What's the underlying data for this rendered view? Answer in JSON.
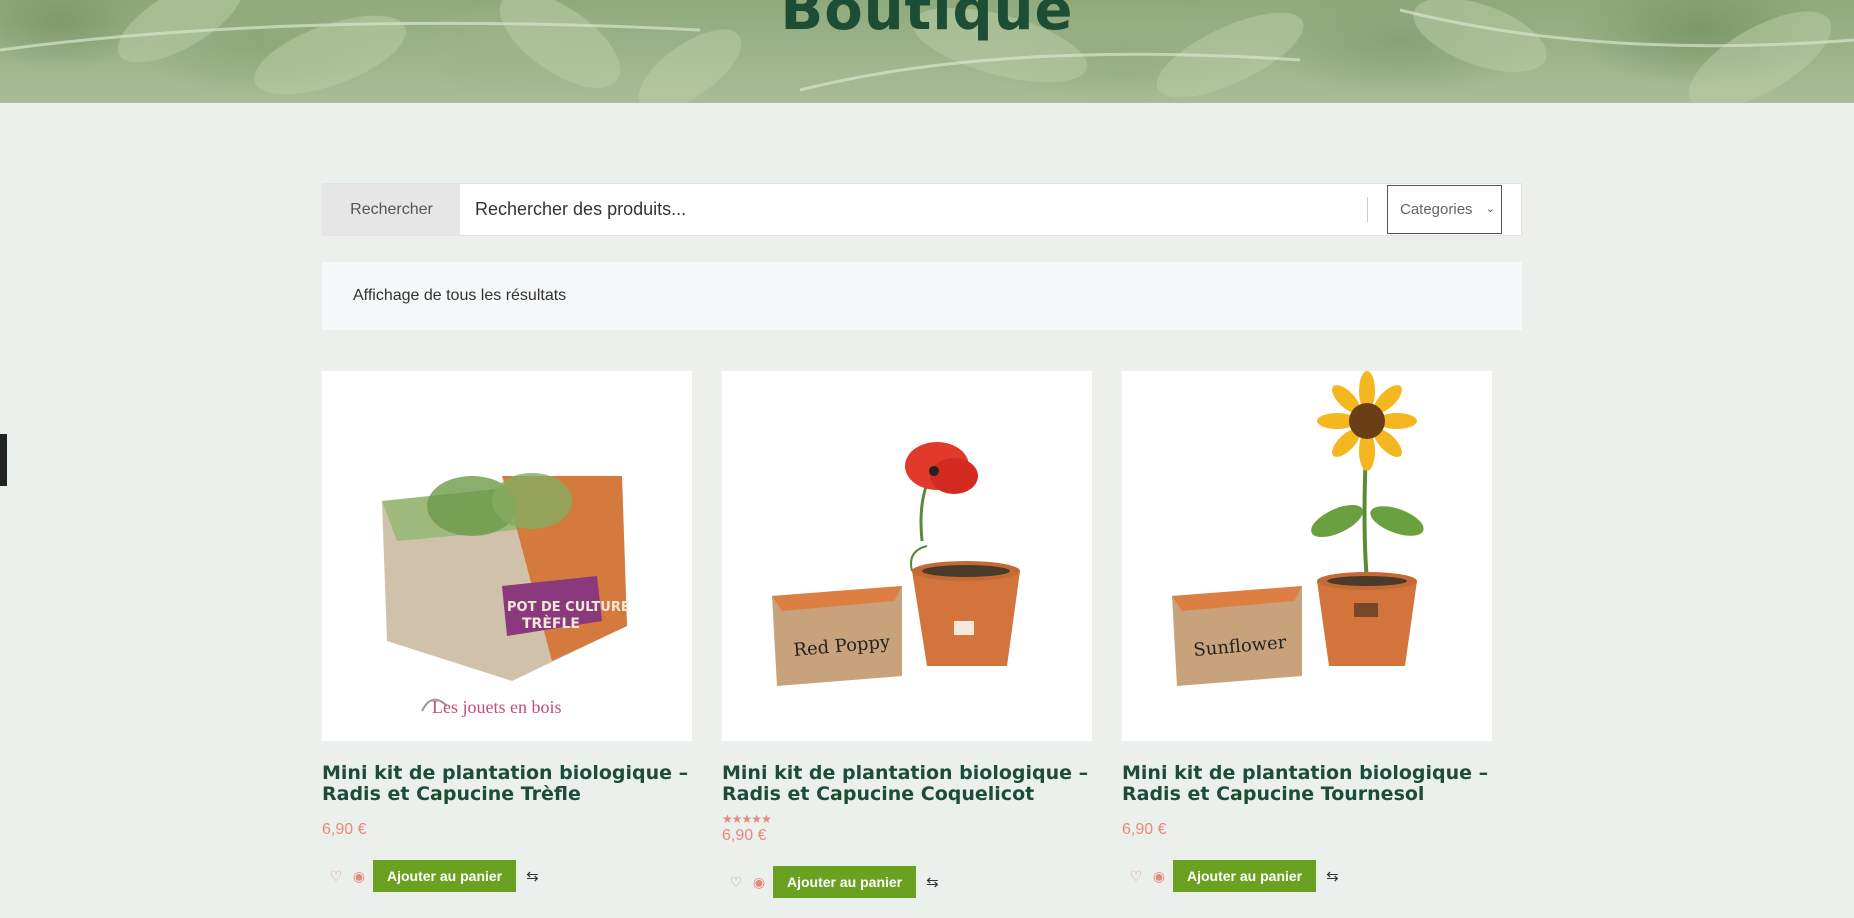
{
  "hero": {
    "title": "Boutique"
  },
  "search": {
    "label": "Rechercher",
    "placeholder": "Rechercher des produits...",
    "category": "Categories"
  },
  "results": {
    "text": "Affichage de tous les résultats"
  },
  "products": [
    {
      "title_line1": "Mini kit de plantation biologique –",
      "title_line2": "Radis et Capucine Trèfle",
      "price": "6,90 €",
      "rating": "",
      "image_text": "Les jouets en bois",
      "button": "Ajouter au panier"
    },
    {
      "title_line1": "Mini kit de plantation biologique –",
      "title_line2": "Radis et Capucine Coquelicot",
      "price": "6,90 €",
      "rating": "★★★★★",
      "image_text": "Red Poppy",
      "button": "Ajouter au panier"
    },
    {
      "title_line1": "Mini kit de plantation biologique –",
      "title_line2": "Radis et Capucine Tournesol",
      "price": "6,90 €",
      "rating": "",
      "image_text": "Sunflower",
      "button": "Ajouter au panier"
    }
  ],
  "colors": {
    "brand_green": "#1d4d35",
    "button_green": "#6aa121",
    "price": "#e58a7b",
    "page_bg": "#ecf0ec"
  },
  "icons": [
    "heart-icon",
    "eye-icon",
    "compare-icon",
    "chevron-down-icon"
  ]
}
